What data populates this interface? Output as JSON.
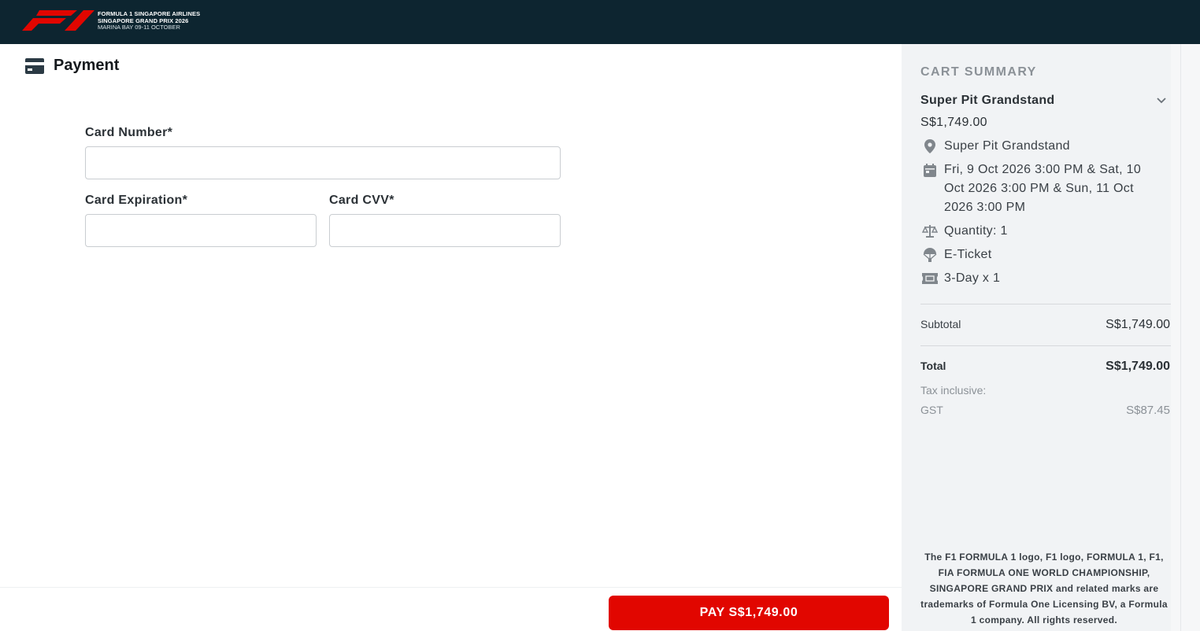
{
  "header": {
    "logo": "f1-logo",
    "brand_line1": "FORMULA 1 SINGAPORE AIRLINES",
    "brand_line2": "SINGAPORE GRAND PRIX 2026",
    "brand_line3": "MARINA BAY 09-11 OCTOBER"
  },
  "payment": {
    "title": "Payment",
    "icon": "credit-card-icon",
    "card_number_label": "Card Number*",
    "card_number_value": "",
    "card_expiration_label": "Card Expiration*",
    "card_expiration_value": "",
    "card_cvv_label": "Card CVV*",
    "card_cvv_value": ""
  },
  "footer": {
    "pay_label": "PAY S$1,749.00",
    "pay_color": "#e10600"
  },
  "cart": {
    "title": "CART SUMMARY",
    "item_name": "Super Pit Grandstand",
    "item_price": "S$1,749.00",
    "details": [
      {
        "icon": "location-pin-icon",
        "text": "Super Pit Grandstand"
      },
      {
        "icon": "calendar-icon",
        "text": "Fri, 9 Oct 2026 3:00 PM & Sat, 10 Oct 2026 3:00 PM & Sun, 11 Oct 2026 3:00 PM"
      },
      {
        "icon": "scale-icon",
        "text": "Quantity: 1"
      },
      {
        "icon": "parachute-icon",
        "text": "E-Ticket"
      },
      {
        "icon": "ticket-icon",
        "text": "3-Day x 1"
      }
    ],
    "subtotal_label": "Subtotal",
    "subtotal_value": "S$1,749.00",
    "total_label": "Total",
    "total_value": "S$1,749.00",
    "tax_label": "Tax inclusive:",
    "gst_label": "GST",
    "gst_value": "S$87.45",
    "legal": "The F1 FORMULA 1 logo, F1 logo, FORMULA 1, F1, FIA FORMULA ONE WORLD CHAMPIONSHIP, SINGAPORE GRAND PRIX and related marks are trademarks of Formula One Licensing BV, a Formula 1 company. All rights reserved."
  },
  "colors": {
    "header_bg": "#0d2530",
    "sidebar_bg": "#f1f3f5",
    "accent": "#e10600"
  }
}
